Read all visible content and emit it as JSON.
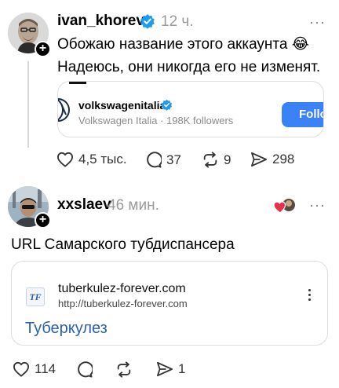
{
  "post1": {
    "username": "ivan_khorev",
    "time": "12 ч.",
    "more": "···",
    "text_line1": "Обожаю название этого аккаунта 😂",
    "text_line2": "Надеюсь, они никогда его не изменят.",
    "embed": {
      "name": "volkswagenitalia",
      "subtitle": "Volkswagen Italia · 198K followers",
      "follow_label": "Follow"
    },
    "stats": {
      "likes": "4,5 тыс.",
      "replies": "37",
      "reposts": "9",
      "shares": "298"
    }
  },
  "post2": {
    "username": "xxslaev",
    "time": "46 мин.",
    "more": "···",
    "text": "URL Самарского тубдиспансера",
    "link": {
      "icon_text": "TF",
      "domain": "tuberkulez-forever.com",
      "url": "http://tuberkulez-forever.com",
      "title": "Туберкулез"
    },
    "stats": {
      "likes": "114",
      "replies": "",
      "reposts": "",
      "shares": "1"
    }
  },
  "colors": {
    "verified": "#1d9bf0",
    "follow_button": "#3b82f6",
    "link_title": "#2b5fb0",
    "heart_reaction": "#e8304a"
  },
  "icons": [
    "verified-badge-icon",
    "plus-icon",
    "more-icon",
    "heart-icon",
    "comment-icon",
    "repost-icon",
    "share-icon",
    "kebab-icon"
  ]
}
